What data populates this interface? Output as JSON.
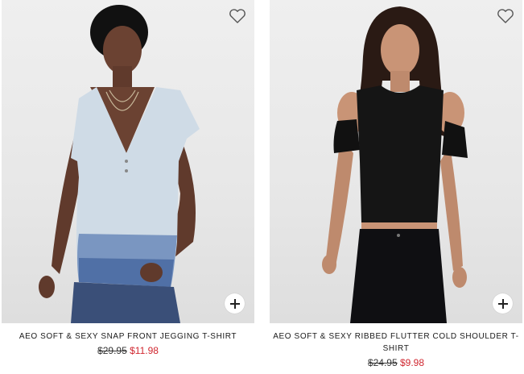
{
  "colors": {
    "sale_price": "#d0262f",
    "text": "#1a1a1a",
    "photo_background": "#ebebeb"
  },
  "products": [
    {
      "name": "AEO SOFT & SEXY SNAP FRONT JEGGING T-SHIRT",
      "original_price": "$29.95",
      "sale_price": "$11.98",
      "wishlist_icon": "heart-outline-icon",
      "quick_add_icon": "plus-icon"
    },
    {
      "name": "AEO SOFT & SEXY RIBBED FLUTTER COLD SHOULDER T-SHIRT",
      "original_price": "$24.95",
      "sale_price": "$9.98",
      "wishlist_icon": "heart-outline-icon",
      "quick_add_icon": "plus-icon"
    }
  ]
}
